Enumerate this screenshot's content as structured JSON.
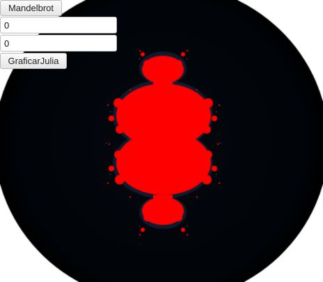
{
  "controls": {
    "mandelbrot_button_label": "Mandelbrot",
    "real_input_value": "0",
    "imag_input_value": "0",
    "graph_julia_button_label": "GraficarJulia"
  },
  "fractal": {
    "type": "Julia set",
    "c_real": 0,
    "c_imag": 0,
    "fill_color": "#ff0000",
    "background_color": "#000000",
    "edge_glow_color": "#0b1a2a"
  }
}
